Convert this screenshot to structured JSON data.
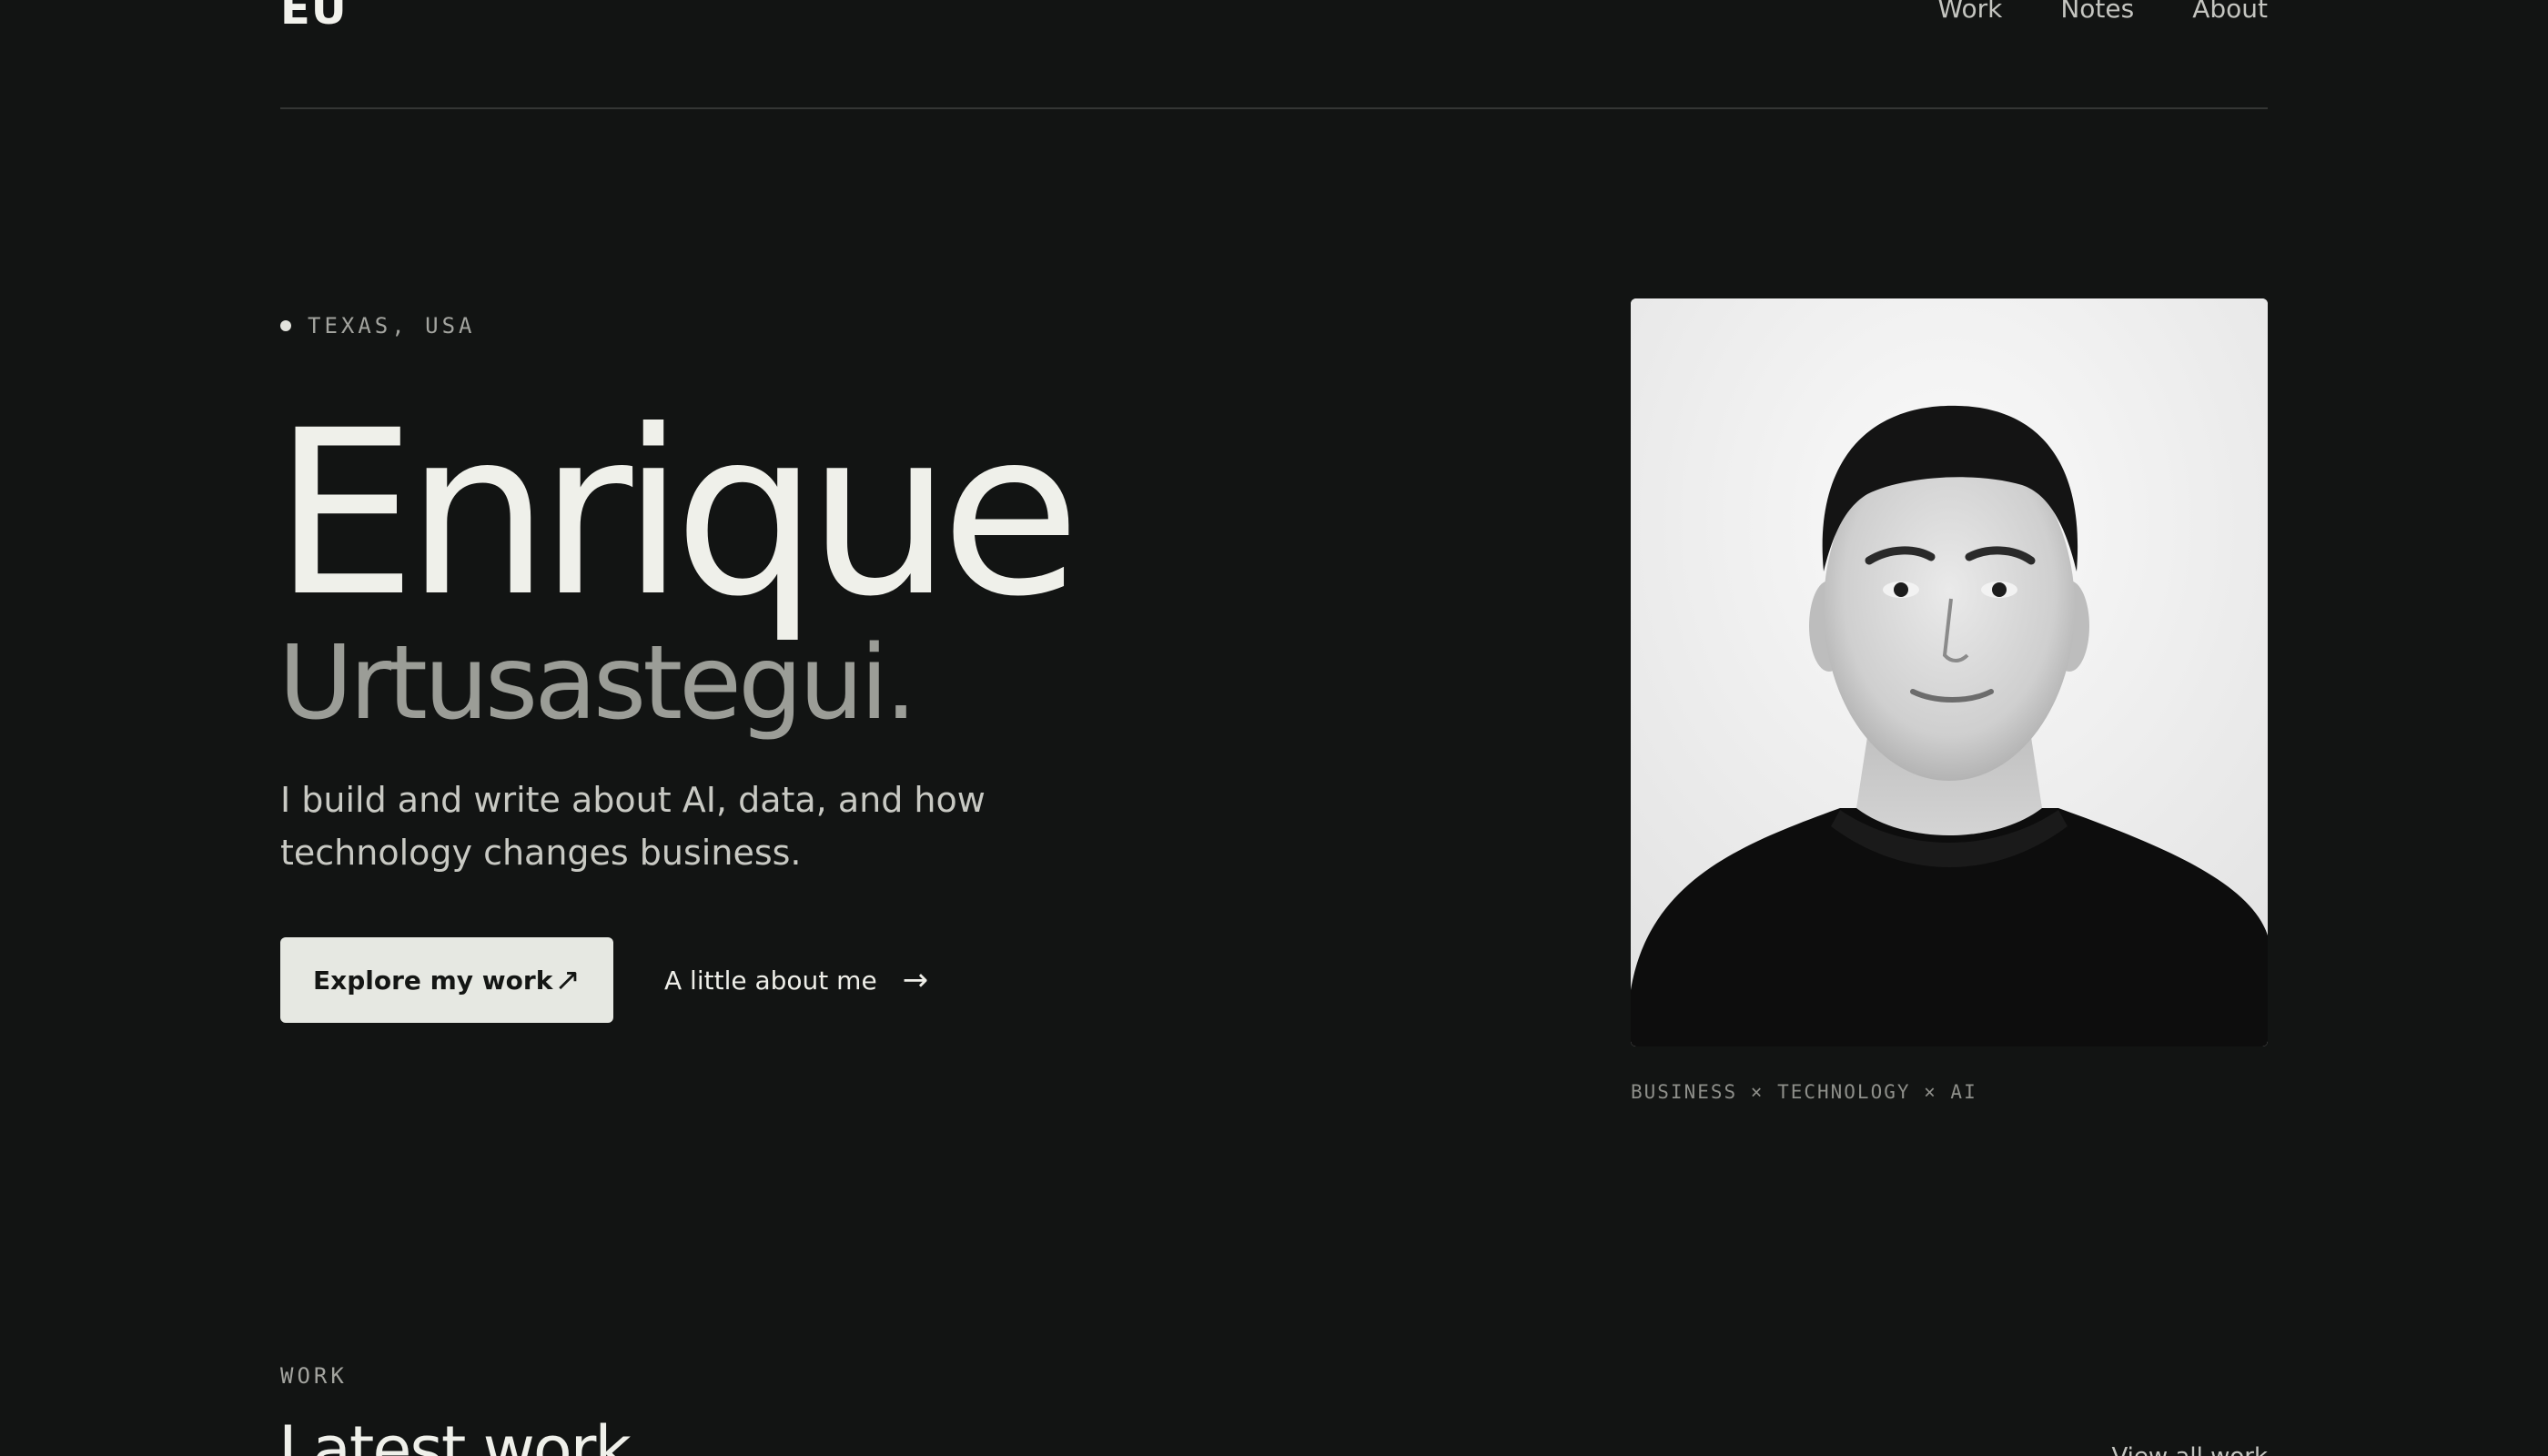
{
  "header": {
    "logo": "EU",
    "nav": [
      {
        "label": "Work"
      },
      {
        "label": "Notes"
      },
      {
        "label": "About"
      }
    ]
  },
  "hero": {
    "location": "TEXAS, USA",
    "first_name": "Enrique",
    "last_name": "Urtusastegui.",
    "tagline": "I build and write about AI, data, and how technology changes business.",
    "primary_cta": {
      "label": "Explore my work",
      "icon": "arrow-up-right-icon"
    },
    "secondary_cta": {
      "label": "A little about me",
      "icon": "arrow-right-icon"
    },
    "portrait_caption": "BUSINESS × TECHNOLOGY × AI"
  },
  "work_section": {
    "label": "WORK",
    "title": "Latest work",
    "view_all": "View all work"
  },
  "colors": {
    "background": "#121413",
    "text_primary": "#eff0ea",
    "text_muted": "#9b9d97",
    "button_bg": "#e6e8e2"
  }
}
